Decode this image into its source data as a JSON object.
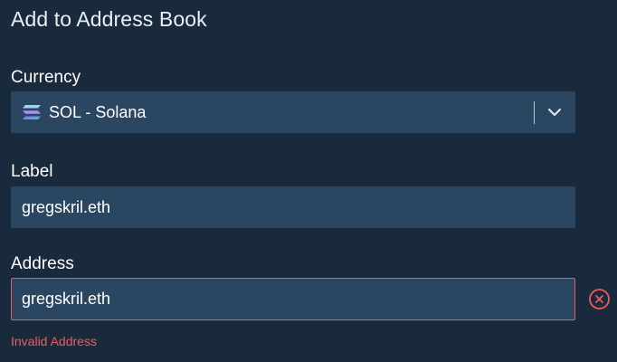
{
  "dialog": {
    "title": "Add to Address Book"
  },
  "currency": {
    "label": "Currency",
    "selected": "SOL - Solana",
    "icon": "solana-logo-icon",
    "expand_icon": "chevron-down-icon"
  },
  "label_field": {
    "label": "Label",
    "value": "gregskril.eth"
  },
  "address_field": {
    "label": "Address",
    "value": "gregskril.eth",
    "error": "Invalid Address",
    "clear_icon": "clear-circle-x-icon"
  },
  "colors": {
    "background": "#1a2a3d",
    "field_background": "#2a4660",
    "error": "#ef5b5b"
  }
}
